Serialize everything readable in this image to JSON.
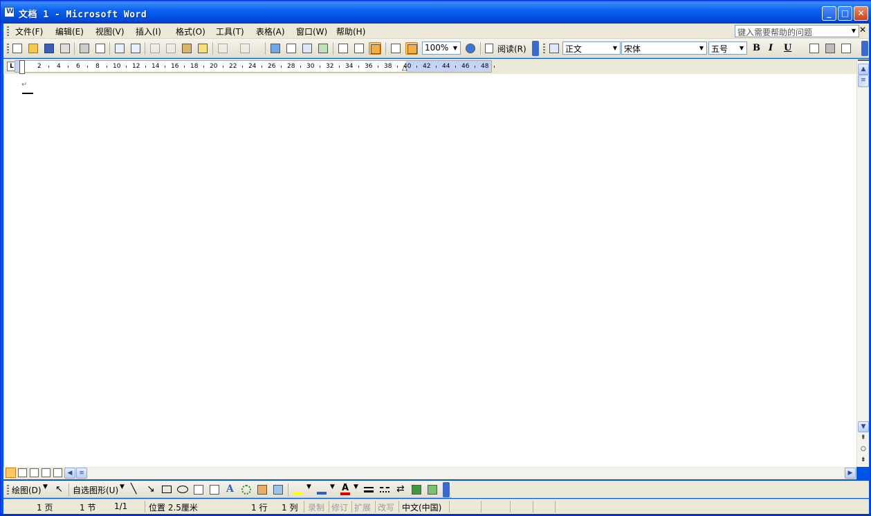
{
  "window": {
    "title": "文档 1 - Microsoft Word"
  },
  "menubar": {
    "items": [
      "文件(F)",
      "编辑(E)",
      "视图(V)",
      "插入(I)",
      "格式(O)",
      "工具(T)",
      "表格(A)",
      "窗口(W)",
      "帮助(H)"
    ],
    "help_placeholder": "键入需要帮助的问题"
  },
  "toolbar": {
    "zoom": "100%",
    "read_label": "阅读(R)",
    "style_value": "正文",
    "font_value": "宋体",
    "size_value": "五号",
    "bold_label": "B",
    "italic_label": "I",
    "underline_label": "U"
  },
  "ruler": {
    "numbers": [
      "2",
      "4",
      "6",
      "8",
      "10",
      "12",
      "14",
      "16",
      "18",
      "20",
      "22",
      "24",
      "26",
      "28",
      "30",
      "32",
      "34",
      "36",
      "38",
      "40",
      "42",
      "44",
      "46",
      "48"
    ]
  },
  "document": {
    "paragraph_mark": "↵"
  },
  "drawing_toolbar": {
    "draw_label": "绘图(D)",
    "autoshapes_label": "自选图形(U)"
  },
  "statusbar": {
    "page": "1 页",
    "section": "1 节",
    "page_of": "1/1",
    "position": "位置 2.5厘米",
    "line": "1 行",
    "column": "1 列",
    "rec": "录制",
    "trk": "修订",
    "ext": "扩展",
    "ovr": "改写",
    "language": "中文(中国)"
  },
  "colors": {
    "titlebar": "#0054e3",
    "chrome": "#ece9d8",
    "highlight_button": "#ffc866"
  }
}
